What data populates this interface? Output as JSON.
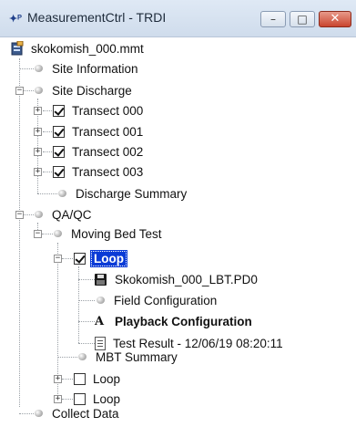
{
  "window": {
    "title": "MeasurementCtrl - TRDI",
    "icon": "trdi-logo-icon",
    "buttons": {
      "minimize": "–",
      "maximize": "□",
      "close": "✕"
    }
  },
  "tree": {
    "root": {
      "label": "skokomish_000.mmt",
      "icon": "measurement-file-icon"
    },
    "site_information": "Site Information",
    "site_discharge": {
      "label": "Site Discharge",
      "transects": [
        {
          "label": "Transect 000",
          "checked": true
        },
        {
          "label": "Transect 001",
          "checked": true
        },
        {
          "label": "Transect 002",
          "checked": true
        },
        {
          "label": "Transect 003",
          "checked": true
        }
      ],
      "summary": "Discharge Summary"
    },
    "qaqc": {
      "label": "QA/QC",
      "moving_bed_test": {
        "label": "Moving Bed Test",
        "loop_selected": {
          "label": "Loop",
          "checked": true
        },
        "loop_children": {
          "file": "Skokomish_000_LBT.PD0",
          "field_config": "Field Configuration",
          "playback_config": "Playback Configuration",
          "test_result": "Test Result - 12/06/19 08:20:11"
        },
        "mbt_summary": "MBT Summary",
        "loops": [
          {
            "label": "Loop",
            "checked": false
          },
          {
            "label": "Loop",
            "checked": false
          }
        ]
      }
    },
    "collect_data": "Collect Data"
  },
  "colors": {
    "selection": "#0a3bd6",
    "close_button": "#c9452f",
    "titlebar": "#dfe9f5"
  }
}
